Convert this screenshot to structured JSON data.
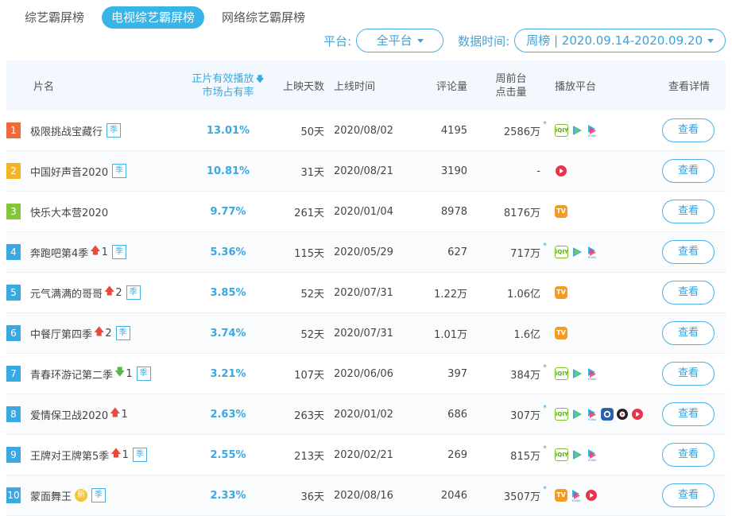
{
  "tabs": [
    {
      "label": "综艺霸屏榜",
      "active": false
    },
    {
      "label": "电视综艺霸屏榜",
      "active": true
    },
    {
      "label": "网络综艺霸屏榜",
      "active": false
    }
  ],
  "filters": {
    "platform_label": "平台:",
    "platform_value": "全平台",
    "time_label": "数据时间:",
    "time_value": "周榜 | 2020.09.14-2020.09.20"
  },
  "headers": {
    "name": "片名",
    "share_line1": "正片有效播放",
    "share_line2": "市场占有率",
    "days": "上映天数",
    "date": "上线时间",
    "comments": "评论量",
    "clicks_line1": "周前台",
    "clicks_line2": "点击量",
    "platforms": "播放平台",
    "details": "查看详情"
  },
  "rows": [
    {
      "rank": "1",
      "rank_color": "#f06a3c",
      "title": "极限挑战宝藏行",
      "trend": "",
      "trend_num": "",
      "badge": "季",
      "share": "13.01%",
      "days": "50天",
      "date": "2020/08/02",
      "comments": "4195",
      "clicks": "2586万",
      "star": "*",
      "platforms": [
        "iqiyi-icon",
        "tencent-video-icon",
        "youku-icon"
      ],
      "button": "查看"
    },
    {
      "rank": "2",
      "rank_color": "#f4b520",
      "title": "中国好声音2020",
      "trend": "",
      "trend_num": "",
      "badge": "季",
      "share": "10.81%",
      "days": "31天",
      "date": "2020/08/21",
      "comments": "3190",
      "clicks": "-",
      "star": "",
      "platforms": [
        "red-play-icon"
      ],
      "button": "查看"
    },
    {
      "rank": "3",
      "rank_color": "#86c43d",
      "title": "快乐大本营2020",
      "trend": "",
      "trend_num": "",
      "badge": "",
      "share": "9.77%",
      "days": "261天",
      "date": "2020/01/04",
      "comments": "8978",
      "clicks": "8176万",
      "star": "",
      "platforms": [
        "mgtv-icon"
      ],
      "button": "查看"
    },
    {
      "rank": "4",
      "rank_color": "#39a8e3",
      "title": "奔跑吧第4季",
      "trend": "up",
      "trend_num": "1",
      "badge": "季",
      "share": "5.36%",
      "days": "115天",
      "date": "2020/05/29",
      "comments": "627",
      "clicks": "717万",
      "star": "*",
      "platforms": [
        "iqiyi-icon",
        "tencent-video-icon",
        "youku-icon"
      ],
      "button": "查看"
    },
    {
      "rank": "5",
      "rank_color": "#39a8e3",
      "title": "元气满满的哥哥",
      "trend": "up",
      "trend_num": "2",
      "badge": "季",
      "share": "3.85%",
      "days": "52天",
      "date": "2020/07/31",
      "comments": "1.22万",
      "clicks": "1.06亿",
      "star": "",
      "platforms": [
        "mgtv-icon"
      ],
      "button": "查看"
    },
    {
      "rank": "6",
      "rank_color": "#39a8e3",
      "title": "中餐厅第四季",
      "trend": "up",
      "trend_num": "2",
      "badge": "季",
      "share": "3.74%",
      "days": "52天",
      "date": "2020/07/31",
      "comments": "1.01万",
      "clicks": "1.6亿",
      "star": "",
      "platforms": [
        "mgtv-icon"
      ],
      "button": "查看"
    },
    {
      "rank": "7",
      "rank_color": "#39a8e3",
      "title": "青春环游记第二季",
      "trend": "down",
      "trend_num": "1",
      "badge": "季",
      "share": "3.21%",
      "days": "107天",
      "date": "2020/06/06",
      "comments": "397",
      "clicks": "384万",
      "star": "*",
      "platforms": [
        "iqiyi-icon",
        "tencent-video-icon",
        "youku-icon"
      ],
      "button": "查看"
    },
    {
      "rank": "8",
      "rank_color": "#39a8e3",
      "title": "爱情保卫战2020",
      "trend": "up",
      "trend_num": "1",
      "badge": "",
      "share": "2.63%",
      "days": "263天",
      "date": "2020/01/02",
      "comments": "686",
      "clicks": "307万",
      "star": "*",
      "platforms": [
        "iqiyi-icon",
        "tencent-video-icon",
        "youku-icon",
        "bilibili-icon",
        "camera-icon",
        "red-play-icon"
      ],
      "button": "查看"
    },
    {
      "rank": "9",
      "rank_color": "#39a8e3",
      "title": "王牌对王牌第5季",
      "trend": "up",
      "trend_num": "1",
      "badge": "季",
      "share": "2.55%",
      "days": "213天",
      "date": "2020/02/21",
      "comments": "269",
      "clicks": "815万",
      "star": "*",
      "platforms": [
        "iqiyi-icon",
        "tencent-video-icon",
        "youku-icon"
      ],
      "button": "查看"
    },
    {
      "rank": "10",
      "rank_color": "#39a8e3",
      "title": "蒙面舞王",
      "trend": "",
      "trend_num": "",
      "badge_new": "新",
      "badge": "季",
      "share": "2.33%",
      "days": "36天",
      "date": "2020/08/16",
      "comments": "2046",
      "clicks": "3507万",
      "star": "*",
      "platforms": [
        "mgtv-icon",
        "youku-icon",
        "red-play-icon"
      ],
      "button": "查看"
    }
  ],
  "icons": {
    "iqiyi-icon": "iQIY",
    "mgtv-icon": "TV",
    "youku-label": "YOUKU"
  },
  "colors": {
    "accent": "#39a8e3",
    "up": "#e84b3c",
    "down": "#5bb450"
  }
}
